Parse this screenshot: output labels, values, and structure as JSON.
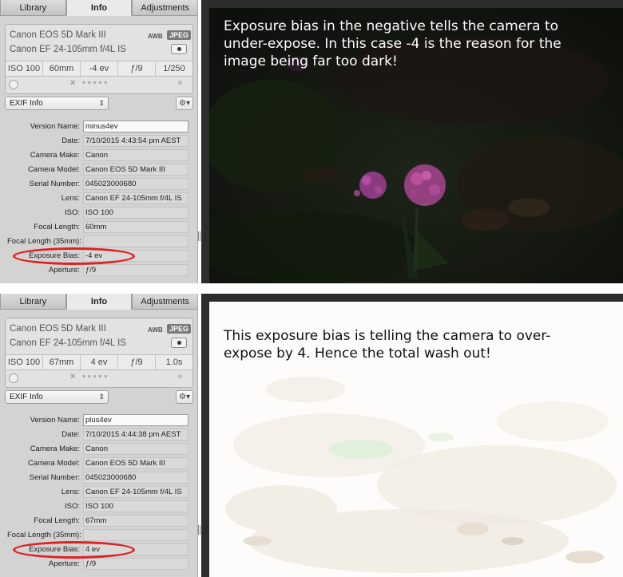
{
  "screens": [
    {
      "tabs": [
        "Library",
        "Info",
        "Adjustments"
      ],
      "active_tab": "Info",
      "camera": {
        "model": "Canon EOS 5D Mark III",
        "lens": "Canon EF 24-105mm f/4L IS",
        "awb": "AWB",
        "format": "JPEG"
      },
      "stats": [
        "ISO 100",
        "60mm",
        "-4 ev",
        "ƒ/9",
        "1/250"
      ],
      "exif_select": "EXIF Info",
      "fields": [
        {
          "label": "Version Name:",
          "value": "minus4ev"
        },
        {
          "label": "Date:",
          "value": "7/10/2015 4:43:54 pm AEST"
        },
        {
          "label": "Camera Make:",
          "value": "Canon"
        },
        {
          "label": "Camera Model:",
          "value": "Canon EOS 5D Mark III"
        },
        {
          "label": "Serial Number:",
          "value": "045023000680"
        },
        {
          "label": "Lens:",
          "value": "Canon EF 24-105mm f/4L IS"
        },
        {
          "label": "ISO:",
          "value": "ISO 100"
        },
        {
          "label": "Focal Length:",
          "value": "60mm"
        },
        {
          "label": "Focal Length (35mm):",
          "value": ""
        },
        {
          "label": "Exposure Bias:",
          "value": "-4 ev"
        },
        {
          "label": "Aperture:",
          "value": "ƒ/9"
        }
      ],
      "caption": "Exposure bias in the negative tells the camera to under-expose. In this case -4 is the reason for the image being far too dark!"
    },
    {
      "tabs": [
        "Library",
        "Info",
        "Adjustments"
      ],
      "active_tab": "Info",
      "camera": {
        "model": "Canon EOS 5D Mark III",
        "lens": "Canon EF 24-105mm f/4L IS",
        "awb": "AWB",
        "format": "JPEG"
      },
      "stats": [
        "ISO 100",
        "67mm",
        "4 ev",
        "ƒ/9",
        "1.0s"
      ],
      "exif_select": "EXIF Info",
      "fields": [
        {
          "label": "Version Name:",
          "value": "plus4ev"
        },
        {
          "label": "Date:",
          "value": "7/10/2015 4:44:38 pm AEST"
        },
        {
          "label": "Camera Make:",
          "value": "Canon"
        },
        {
          "label": "Camera Model:",
          "value": "Canon EOS 5D Mark III"
        },
        {
          "label": "Serial Number:",
          "value": "045023000680"
        },
        {
          "label": "Lens:",
          "value": "Canon EF 24-105mm f/4L IS"
        },
        {
          "label": "ISO:",
          "value": "ISO 100"
        },
        {
          "label": "Focal Length:",
          "value": "67mm"
        },
        {
          "label": "Focal Length (35mm):",
          "value": ""
        },
        {
          "label": "Exposure Bias:",
          "value": "4 ev"
        },
        {
          "label": "Aperture:",
          "value": "ƒ/9"
        }
      ],
      "caption": "This exposure bias is telling the camera to over-expose by 4. Hence the total wash out!"
    }
  ],
  "colors": {
    "highlight": "#e0201f",
    "sidebar_bg": "#d3d3d3",
    "viewer_bg": "#2d2d2d"
  },
  "icons": {
    "gear": "gear-icon",
    "select_arrows": "updown-arrows-icon",
    "record": "record-icon",
    "flag": "flag-icon"
  }
}
